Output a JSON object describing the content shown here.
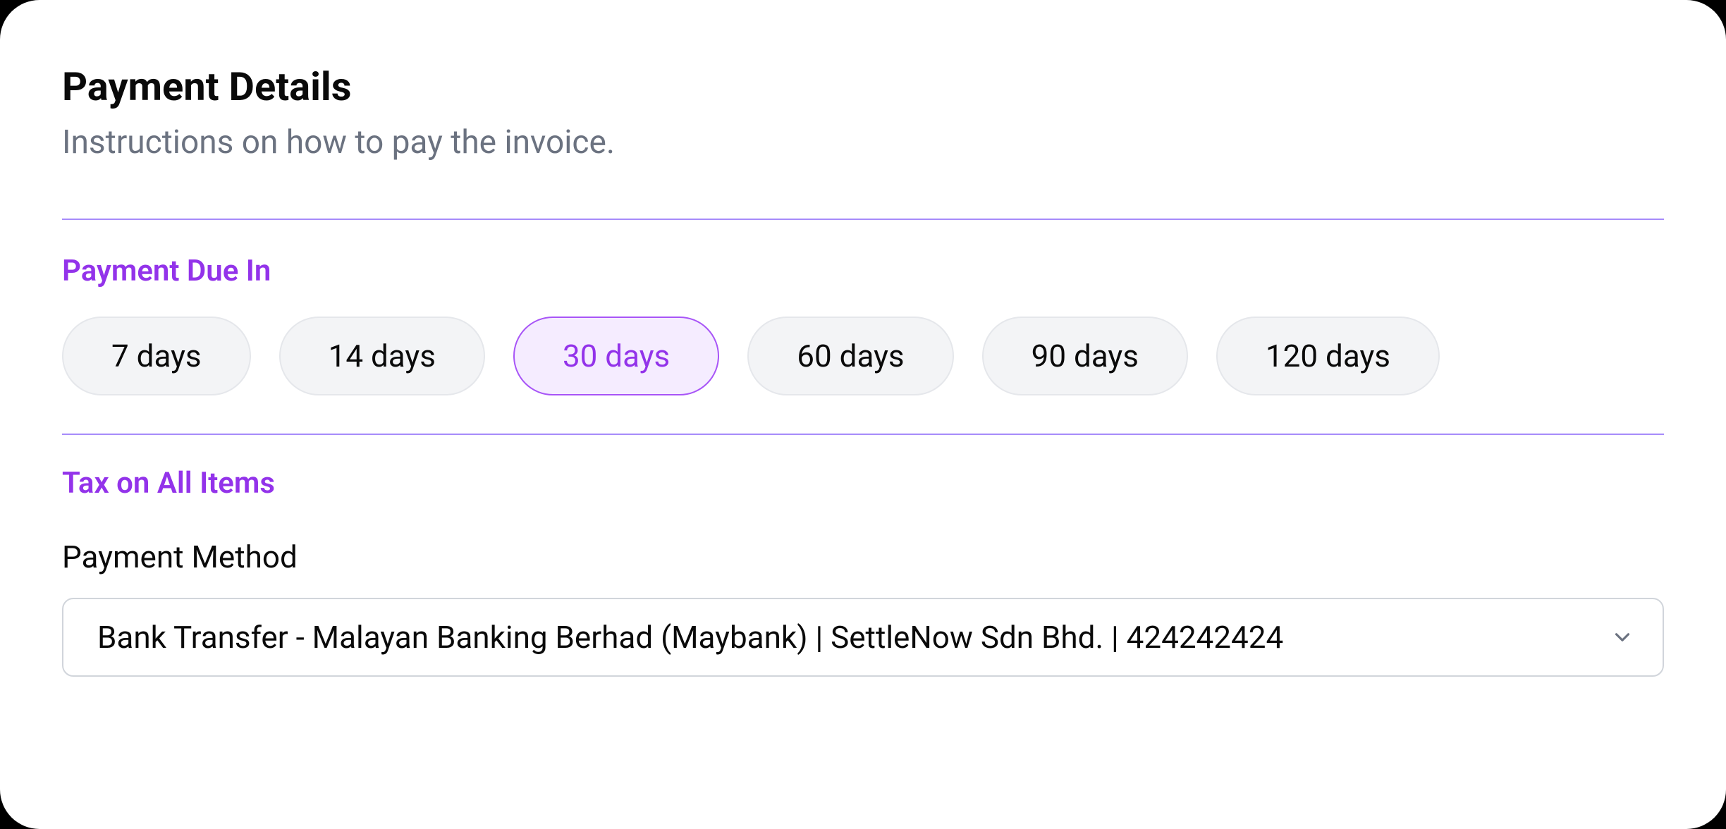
{
  "card": {
    "title": "Payment Details",
    "subtitle": "Instructions on how to pay the invoice."
  },
  "paymentDue": {
    "label": "Payment Due In",
    "options": [
      "7 days",
      "14 days",
      "30 days",
      "60 days",
      "90 days",
      "120 days"
    ],
    "selected": "30 days"
  },
  "tax": {
    "label": "Tax on All Items"
  },
  "paymentMethod": {
    "label": "Payment Method",
    "selected": "Bank Transfer - Malayan Banking Berhad (Maybank) | SettleNow Sdn Bhd. | 424242424"
  }
}
